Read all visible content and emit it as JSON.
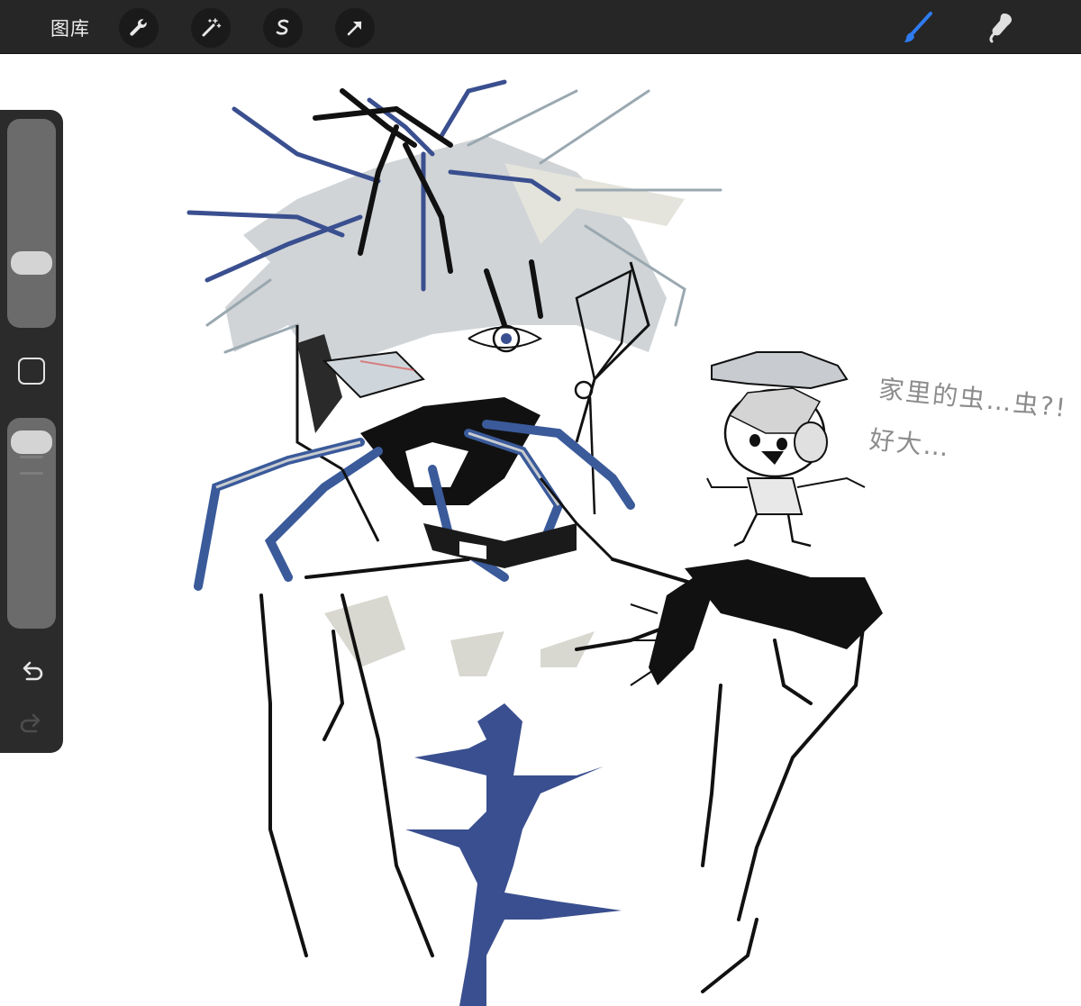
{
  "toolbar": {
    "gallery_label": "图库",
    "tools_left": [
      "wrench-icon",
      "magic-wand-icon",
      "selection-s-icon",
      "arrow-transform-icon"
    ],
    "tools_right": [
      "brush-icon",
      "smudge-icon",
      "eraser-icon"
    ],
    "accent_color": "#2f7bf0",
    "bar_color": "#262626"
  },
  "sidebar": {
    "brush_size_level": 0.72,
    "opacity_level": 0.05,
    "controls": [
      "brush-size-slider",
      "modify-button",
      "opacity-slider",
      "undo-icon",
      "redo-icon"
    ]
  },
  "canvas": {
    "handwriting_line1": "家里的虫…虫?!",
    "handwriting_line2": "好大…",
    "ink_color": "#111111",
    "blue_color": "#3a4f8f",
    "gray_color": "#c8ccd0"
  }
}
